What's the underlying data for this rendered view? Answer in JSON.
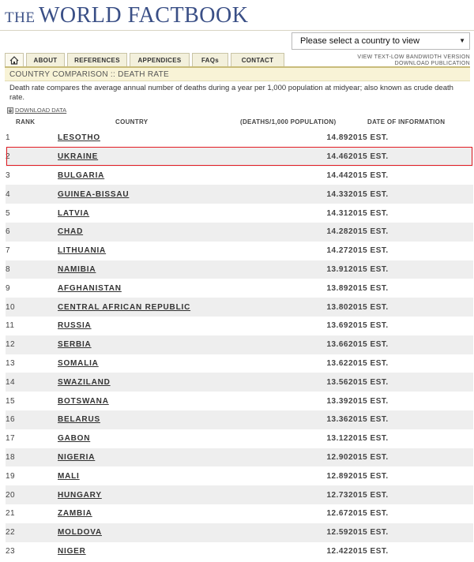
{
  "site_title": "THE WORLD FACTBOOK",
  "site_title_parts": {
    "the": "THE",
    "main": "WORLD FACTBOOK"
  },
  "country_select": {
    "placeholder": "Please select a country to view"
  },
  "nav": {
    "tabs": [
      "ABOUT",
      "REFERENCES",
      "APPENDICES",
      "FAQs",
      "CONTACT"
    ],
    "links": [
      "VIEW TEXT-LOW BANDWIDTH VERSION",
      "DOWNLOAD PUBLICATION"
    ]
  },
  "page_title": "COUNTRY COMPARISON :: DEATH RATE",
  "description": "Death rate compares the average annual number of deaths during a year per 1,000 population at midyear; also known as crude death rate.",
  "download_label": "DOWNLOAD DATA",
  "table": {
    "headers": [
      "RANK",
      "COUNTRY",
      "(DEATHS/1,000 POPULATION)",
      "DATE OF INFORMATION"
    ],
    "rows": [
      {
        "rank": "1",
        "country": "LESOTHO",
        "value": "14.89",
        "date": "2015 EST."
      },
      {
        "rank": "2",
        "country": "UKRAINE",
        "value": "14.46",
        "date": "2015 EST."
      },
      {
        "rank": "3",
        "country": "BULGARIA",
        "value": "14.44",
        "date": "2015 EST."
      },
      {
        "rank": "4",
        "country": "GUINEA-BISSAU",
        "value": "14.33",
        "date": "2015 EST."
      },
      {
        "rank": "5",
        "country": "LATVIA",
        "value": "14.31",
        "date": "2015 EST."
      },
      {
        "rank": "6",
        "country": "CHAD",
        "value": "14.28",
        "date": "2015 EST."
      },
      {
        "rank": "7",
        "country": "LITHUANIA",
        "value": "14.27",
        "date": "2015 EST."
      },
      {
        "rank": "8",
        "country": "NAMIBIA",
        "value": "13.91",
        "date": "2015 EST."
      },
      {
        "rank": "9",
        "country": "AFGHANISTAN",
        "value": "13.89",
        "date": "2015 EST."
      },
      {
        "rank": "10",
        "country": "CENTRAL AFRICAN REPUBLIC",
        "value": "13.80",
        "date": "2015 EST."
      },
      {
        "rank": "11",
        "country": "RUSSIA",
        "value": "13.69",
        "date": "2015 EST."
      },
      {
        "rank": "12",
        "country": "SERBIA",
        "value": "13.66",
        "date": "2015 EST."
      },
      {
        "rank": "13",
        "country": "SOMALIA",
        "value": "13.62",
        "date": "2015 EST."
      },
      {
        "rank": "14",
        "country": "SWAZILAND",
        "value": "13.56",
        "date": "2015 EST."
      },
      {
        "rank": "15",
        "country": "BOTSWANA",
        "value": "13.39",
        "date": "2015 EST."
      },
      {
        "rank": "16",
        "country": "BELARUS",
        "value": "13.36",
        "date": "2015 EST."
      },
      {
        "rank": "17",
        "country": "GABON",
        "value": "13.12",
        "date": "2015 EST."
      },
      {
        "rank": "18",
        "country": "NIGERIA",
        "value": "12.90",
        "date": "2015 EST."
      },
      {
        "rank": "19",
        "country": "MALI",
        "value": "12.89",
        "date": "2015 EST."
      },
      {
        "rank": "20",
        "country": "HUNGARY",
        "value": "12.73",
        "date": "2015 EST."
      },
      {
        "rank": "21",
        "country": "ZAMBIA",
        "value": "12.67",
        "date": "2015 EST."
      },
      {
        "rank": "22",
        "country": "MOLDOVA",
        "value": "12.59",
        "date": "2015 EST."
      },
      {
        "rank": "23",
        "country": "NIGER",
        "value": "12.42",
        "date": "2015 EST."
      }
    ],
    "highlighted_rank": "2"
  },
  "colors": {
    "title_blue": "#3a4f86",
    "highlight_border": "#e31b23",
    "row_alt": "#eeeeee",
    "title_bar": "#f8f3d6"
  }
}
